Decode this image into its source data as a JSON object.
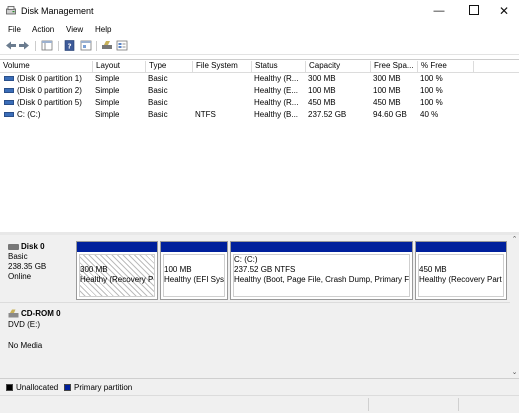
{
  "window": {
    "title": "Disk Management",
    "min": "—",
    "max": "",
    "close": "✕"
  },
  "menu": [
    "File",
    "Action",
    "View",
    "Help"
  ],
  "toolbar": [
    "back-icon",
    "forward-icon",
    "show-hide-tree-icon",
    "help-icon",
    "properties-icon",
    "disk-icon",
    "list-view-icon"
  ],
  "volumes": {
    "headers": [
      "Volume",
      "Layout",
      "Type",
      "File System",
      "Status",
      "Capacity",
      "Free Spa...",
      "% Free"
    ],
    "rows": [
      [
        "(Disk 0 partition 1)",
        "Simple",
        "Basic",
        "",
        "Healthy (R...",
        "300 MB",
        "300 MB",
        "100 %"
      ],
      [
        "(Disk 0 partition 2)",
        "Simple",
        "Basic",
        "",
        "Healthy (E...",
        "100 MB",
        "100 MB",
        "100 %"
      ],
      [
        "(Disk 0 partition 5)",
        "Simple",
        "Basic",
        "",
        "Healthy (R...",
        "450 MB",
        "450 MB",
        "100 %"
      ],
      [
        "C: (C:)",
        "Simple",
        "Basic",
        "NTFS",
        "Healthy (B...",
        "237.52 GB",
        "94.60 GB",
        "40 %"
      ]
    ]
  },
  "disks": [
    {
      "name": "Disk 0",
      "type": "Basic",
      "size": "238.35 GB",
      "status": "Online",
      "partitions": [
        {
          "label": "",
          "size": "300 MB",
          "status": "Healthy (Recovery P"
        },
        {
          "label": "",
          "size": "100 MB",
          "status": "Healthy (EFI Sys"
        },
        {
          "label": "C:  (C:)",
          "size": "237.52 GB NTFS",
          "status": "Healthy (Boot, Page File, Crash Dump, Primary F"
        },
        {
          "label": "",
          "size": "450 MB",
          "status": "Healthy (Recovery Part"
        }
      ]
    },
    {
      "name": "CD-ROM 0",
      "type": "DVD (E:)",
      "status": "No Media"
    }
  ],
  "legend": [
    {
      "label": "Unallocated",
      "color": "#000000"
    },
    {
      "label": "Primary partition",
      "color": "#00209c"
    }
  ],
  "colors": {
    "partition_bar": "#00209c",
    "selected_hatch": "#bdbdbd"
  }
}
